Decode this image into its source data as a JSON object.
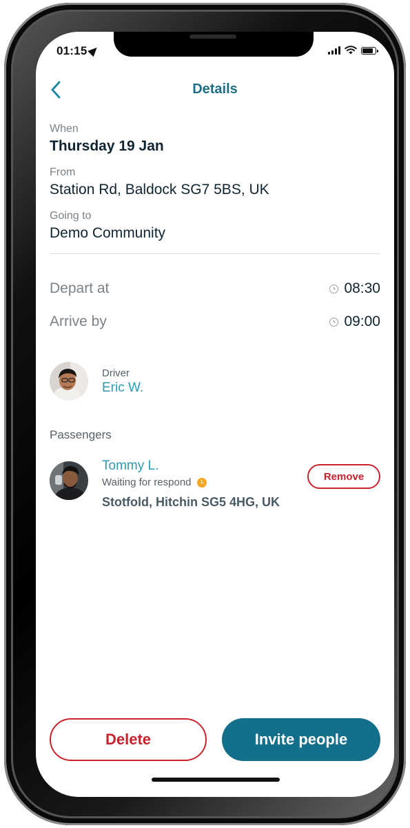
{
  "status_bar": {
    "time": "01:15"
  },
  "nav": {
    "title": "Details"
  },
  "trip": {
    "when_label": "When",
    "when_value": "Thursday 19 Jan",
    "from_label": "From",
    "from_value": "Station Rd, Baldock SG7 5BS, UK",
    "to_label": "Going to",
    "to_value": "Demo Community",
    "depart_label": "Depart at",
    "depart_time": "08:30",
    "arrive_label": "Arrive by",
    "arrive_time": "09:00"
  },
  "driver": {
    "label": "Driver",
    "name": "Eric W."
  },
  "passengers": {
    "label": "Passengers",
    "items": [
      {
        "name": "Tommy L.",
        "status": "Waiting for respond",
        "address": "Stotfold, Hitchin SG5 4HG, UK",
        "remove_label": "Remove"
      }
    ]
  },
  "actions": {
    "delete_label": "Delete",
    "invite_label": "Invite people"
  },
  "colors": {
    "accent": "#136f8a",
    "link": "#2a9bb3",
    "danger": "#c8232c",
    "pending": "#f5a623"
  }
}
